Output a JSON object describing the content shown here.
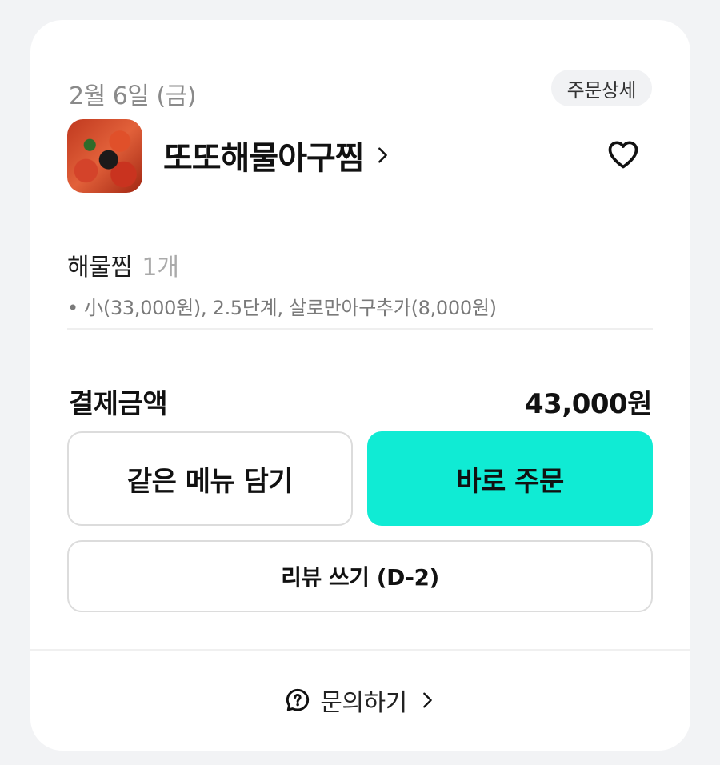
{
  "order": {
    "date": "2월 6일 (금)",
    "detail_label": "주문상세"
  },
  "store": {
    "name": "또또해물아구찜",
    "thumbnail_icon": "food-thumbnail"
  },
  "menu": {
    "name": "해물찜",
    "quantity": "1개",
    "options": "• 小(33,000원), 2.5단계, 살로만아구추가(8,000원)"
  },
  "payment": {
    "label": "결제금액",
    "amount": "43,000원"
  },
  "actions": {
    "same_menu_label": "같은 메뉴 담기",
    "order_now_label": "바로 주문",
    "review_label": "리뷰 쓰기 (D-2)"
  },
  "inquiry": {
    "label": "문의하기"
  },
  "colors": {
    "accent": "#10ebd4",
    "muted": "#8a8a8a",
    "background": "#f2f3f5"
  }
}
